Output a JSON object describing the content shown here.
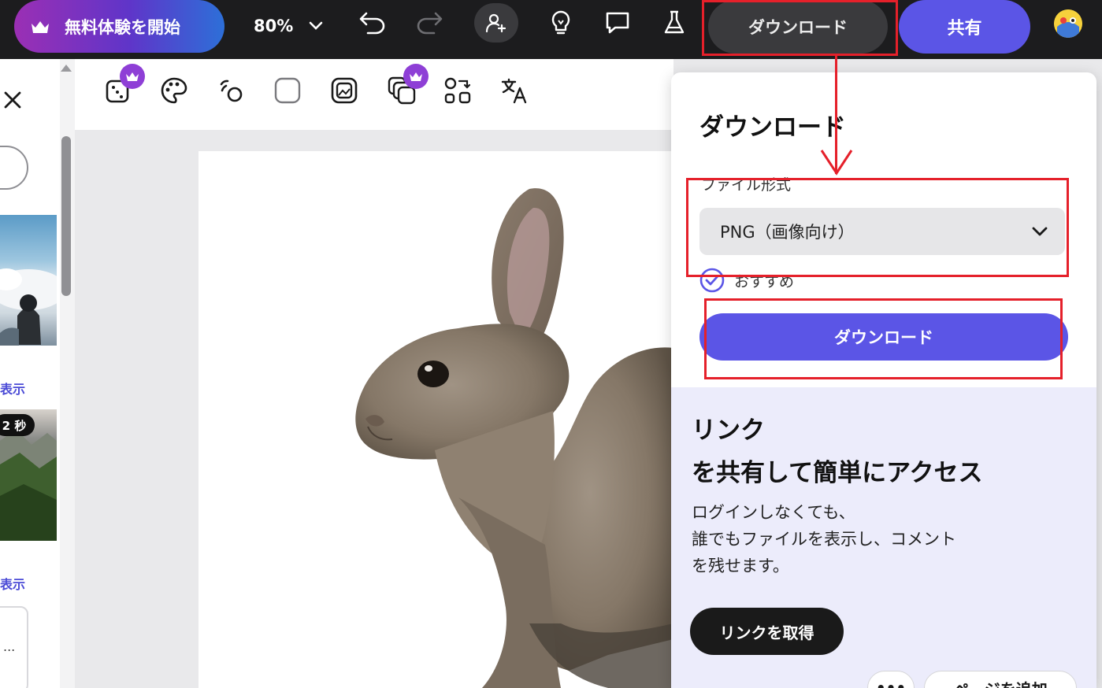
{
  "topbar": {
    "trial_label": "無料体験を開始",
    "zoom_value": "80%",
    "download_label": "ダウンロード",
    "share_label": "共有"
  },
  "left_panel": {
    "show_more_1": "表示",
    "show_more_2": "表示",
    "duration_badge": "2 秒",
    "card_ellipsis": "..."
  },
  "toolbar": {
    "tools": [
      "effects",
      "palette",
      "animate",
      "frame",
      "image-edit",
      "layers",
      "transform",
      "translate"
    ]
  },
  "download_panel": {
    "title": "ダウンロード",
    "format_label": "ファイル形式",
    "format_value": "PNG（画像向け）",
    "recommend_label": "おすすめ",
    "download_button": "ダウンロード",
    "promo_title_line1": "リンク",
    "promo_title_line2": "を共有して簡単にアクセス",
    "promo_body_line1": "ログインしなくても、",
    "promo_body_line2": "誰でもファイルを表示し、コメント",
    "promo_body_line3": "を残せます。",
    "get_link_button": "リンクを取得"
  },
  "bottom": {
    "more_label": "•••",
    "add_page_label": "ページを追加"
  },
  "colors": {
    "accent": "#5b55e6",
    "annotation": "#e5202a",
    "topbar_bg": "#1c1c1e",
    "promo_bg": "#ececfb"
  }
}
